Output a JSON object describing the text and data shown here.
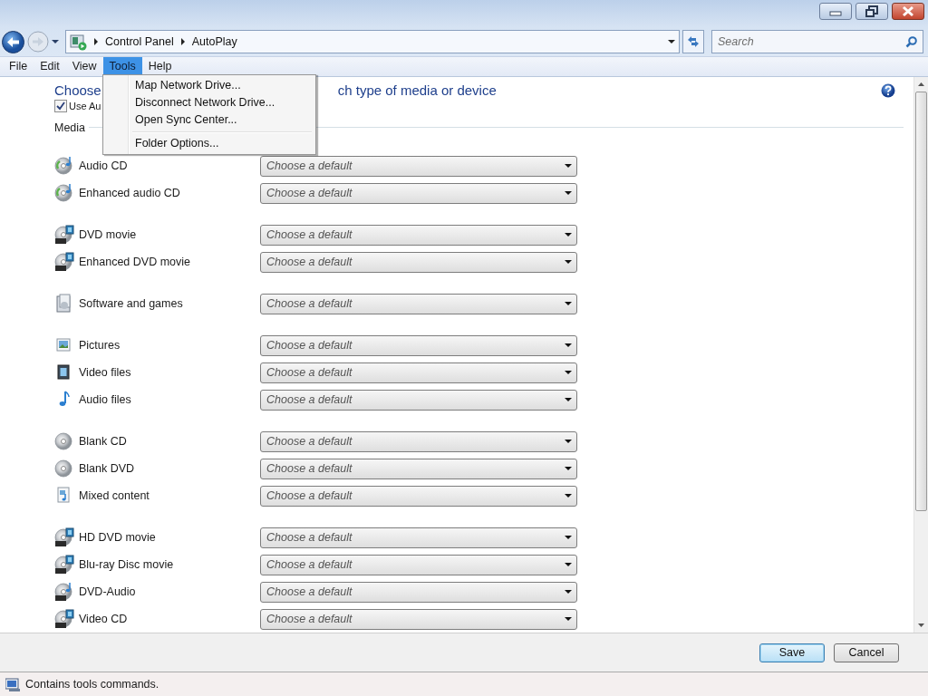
{
  "address": {
    "path": [
      "Control Panel",
      "AutoPlay"
    ]
  },
  "search": {
    "placeholder": "Search"
  },
  "menubar": [
    {
      "label": "File",
      "selected": false
    },
    {
      "label": "Edit",
      "selected": false
    },
    {
      "label": "View",
      "selected": false
    },
    {
      "label": "Tools",
      "selected": true
    },
    {
      "label": "Help",
      "selected": false
    }
  ],
  "open_menu": {
    "groups": [
      [
        "Map Network Drive...",
        "Disconnect Network Drive...",
        "Open Sync Center..."
      ],
      [
        "Folder Options..."
      ]
    ]
  },
  "heading": {
    "visible_start": "Choose",
    "visible_end": "ch type of media or device"
  },
  "use_autoplay": {
    "label": "Use Au",
    "checked": true
  },
  "section": "Media",
  "media_groups": [
    [
      {
        "label": "Audio CD",
        "kind": "cd",
        "selection": "Choose a default"
      },
      {
        "label": "Enhanced audio CD",
        "kind": "cd",
        "selection": "Choose a default"
      }
    ],
    [
      {
        "label": "DVD movie",
        "kind": "dvd",
        "selection": "Choose a default"
      },
      {
        "label": "Enhanced DVD movie",
        "kind": "dvd",
        "selection": "Choose a default"
      }
    ],
    [
      {
        "label": "Software and games",
        "kind": "software",
        "selection": "Choose a default"
      }
    ],
    [
      {
        "label": "Pictures",
        "kind": "pictures",
        "selection": "Choose a default"
      },
      {
        "label": "Video files",
        "kind": "video",
        "selection": "Choose a default"
      },
      {
        "label": "Audio files",
        "kind": "audio",
        "selection": "Choose a default"
      }
    ],
    [
      {
        "label": "Blank CD",
        "kind": "blank",
        "selection": "Choose a default"
      },
      {
        "label": "Blank DVD",
        "kind": "blank",
        "selection": "Choose a default"
      },
      {
        "label": "Mixed content",
        "kind": "mixed",
        "selection": "Choose a default"
      }
    ],
    [
      {
        "label": "HD DVD movie",
        "kind": "dvd",
        "selection": "Choose a default"
      },
      {
        "label": "Blu-ray Disc movie",
        "kind": "dvd",
        "selection": "Choose a default"
      },
      {
        "label": "DVD-Audio",
        "kind": "dvdaudio",
        "selection": "Choose a default"
      },
      {
        "label": "Video CD",
        "kind": "dvd",
        "selection": "Choose a default"
      }
    ]
  ],
  "buttons": [
    {
      "label": "Save",
      "default": true
    },
    {
      "label": "Cancel",
      "default": false
    }
  ],
  "status_bar": {
    "text": "Contains tools commands."
  }
}
